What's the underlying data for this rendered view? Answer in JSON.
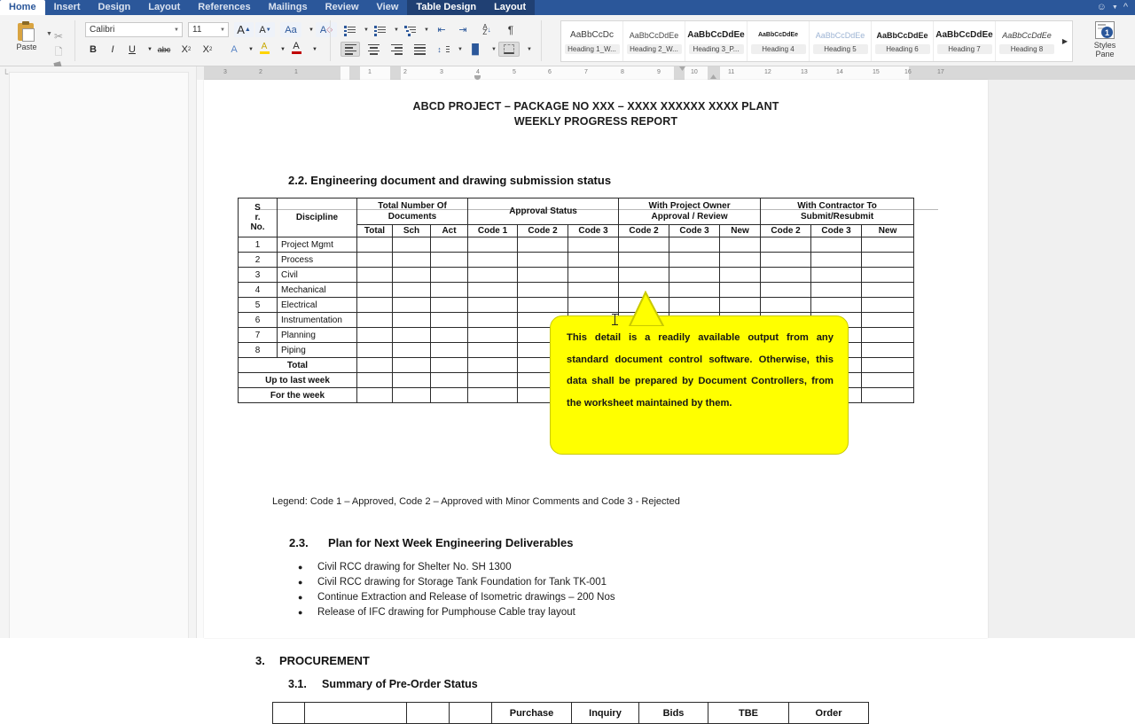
{
  "app": {
    "tabs": [
      {
        "label": "Home",
        "state": "active"
      },
      {
        "label": "Insert",
        "state": "normal"
      },
      {
        "label": "Design",
        "state": "normal"
      },
      {
        "label": "Layout",
        "state": "normal"
      },
      {
        "label": "References",
        "state": "normal"
      },
      {
        "label": "Mailings",
        "state": "normal"
      },
      {
        "label": "Review",
        "state": "normal"
      },
      {
        "label": "View",
        "state": "normal"
      },
      {
        "label": "Table Design",
        "state": "contextual"
      },
      {
        "label": "Layout",
        "state": "contextual"
      }
    ],
    "tabbar_right": {
      "smiley_icon": "smiley-face-icon",
      "collapse_icon": "collapse-ribbon-icon"
    },
    "accent_color": "#2b579a",
    "contextual_tab_color": "#204073"
  },
  "ribbon": {
    "clipboard": {
      "paste_label": "Paste",
      "paste_icon": "clipboard-paste-icon",
      "cut_icon": "scissors-icon",
      "copy_icon": "copy-icon",
      "format_painter_icon": "format-painter-icon"
    },
    "font": {
      "font_name": "Calibri",
      "font_size": "11",
      "grow_font_label": "A",
      "shrink_font_label": "A",
      "change_case_label": "Aa",
      "clear_formatting_icon": "clear-formatting-icon",
      "bold_label": "B",
      "italic_label": "I",
      "underline_label": "U",
      "strikethrough_label": "abc",
      "subscript_label": "X",
      "subscript_index": "2",
      "superscript_label": "X",
      "superscript_index": "2",
      "text_effects_label": "A",
      "highlight_label": "A",
      "font_color_label": "A",
      "highlight_color": "#ffd400",
      "font_color": "#c00000",
      "text_effects_color": "#2b579a"
    },
    "paragraph": {
      "bullets_icon": "bullet-list-icon",
      "numbering_icon": "numbered-list-icon",
      "multilevel_icon": "multilevel-list-icon",
      "decrease_indent_icon": "decrease-indent-icon",
      "increase_indent_icon": "increase-indent-icon",
      "sort_icon": "sort-icon",
      "sort_label": "A\nZ",
      "show_marks_label": "¶",
      "align_left_icon": "align-left-icon",
      "align_center_icon": "align-center-icon",
      "align_right_icon": "align-right-icon",
      "justify_icon": "justify-icon",
      "line_spacing_icon": "line-spacing-icon",
      "shading_icon": "shading-icon",
      "borders_icon": "borders-icon"
    },
    "styles": {
      "items": [
        {
          "sample": "AaBbCcDc",
          "name": "Heading 1_W...",
          "weight": "normal",
          "style": "normal",
          "size": "10px",
          "color": "#3c3c3c"
        },
        {
          "sample": "AaBbCcDdEe",
          "name": "Heading 2_W...",
          "weight": "normal",
          "style": "normal",
          "size": "9px",
          "color": "#4a4a4a"
        },
        {
          "sample": "AaBbCcDdEе",
          "name": "Heading 3_P...",
          "weight": "bold",
          "style": "normal",
          "size": "10px",
          "color": "#1d1d1d"
        },
        {
          "sample": "AaBbCcDdEe",
          "name": "Heading 4",
          "weight": "bold",
          "style": "normal",
          "size": "7px",
          "color": "#1d1d1d"
        },
        {
          "sample": "AaBbCcDdEe",
          "name": "Heading 5",
          "weight": "normal",
          "style": "normal",
          "size": "9px",
          "color": "#9db4d4"
        },
        {
          "sample": "AaBbCcDdEe",
          "name": "Heading 6",
          "weight": "bold",
          "style": "normal",
          "size": "9px",
          "color": "#1d1d1d"
        },
        {
          "sample": "AaBbCcDdEе",
          "name": "Heading 7",
          "weight": "bold",
          "style": "normal",
          "size": "10px",
          "color": "#1d1d1d"
        },
        {
          "sample": "AaBbCcDdEe",
          "name": "Heading 8",
          "weight": "normal",
          "style": "italic",
          "size": "9px",
          "color": "#3c3c3c"
        }
      ],
      "more_icon": "gallery-more-icon",
      "styles_pane_label": "Styles\nPane",
      "styles_pane_label_line1": "Styles",
      "styles_pane_label_line2": "Pane",
      "styles_pane_badge": "1"
    }
  },
  "ruler": {
    "left_ticks": [
      "3",
      "2",
      "1"
    ],
    "right_ticks": [
      "1",
      "2",
      "3",
      "4",
      "5",
      "6",
      "7",
      "8",
      "9",
      "10",
      "11",
      "12",
      "13",
      "14",
      "15",
      "16",
      "17"
    ]
  },
  "document": {
    "header_line1": "ABCD PROJECT – PACKAGE NO XXX – XXXX XXXXXX XXXX PLANT",
    "header_line2": "WEEKLY PROGRESS REPORT",
    "section_22_title": "2.2. Engineering document and drawing submission status",
    "table": {
      "group_headers": [
        {
          "label": "S\nr.\nNo.",
          "lines": [
            "S",
            "r.",
            "No."
          ]
        },
        {
          "label": "Discipline"
        },
        {
          "label": "Total Number Of Documents",
          "lines": [
            "Total Number Of",
            "Documents"
          ]
        },
        {
          "label": "Approval Status",
          "lines": [
            "Approval Status"
          ]
        },
        {
          "label": "With Project Owner Approval / Review",
          "lines": [
            "With Project Owner",
            "Approval / Review"
          ]
        },
        {
          "label": "With Contractor To Submit/Resubmit",
          "lines": [
            "With Contractor To",
            "Submit/Resubmit"
          ]
        }
      ],
      "sub_headers": [
        "Total",
        "Sch",
        "Act",
        "Code 1",
        "Code 2",
        "Code 3",
        "Code 2",
        "Code 3",
        "New",
        "Code 2",
        "Code 3",
        "New"
      ],
      "rows": [
        {
          "sr": "1",
          "discipline": "Project Mgmt"
        },
        {
          "sr": "2",
          "discipline": "Process"
        },
        {
          "sr": "3",
          "discipline": "Civil"
        },
        {
          "sr": "4",
          "discipline": "Mechanical"
        },
        {
          "sr": "5",
          "discipline": "Electrical"
        },
        {
          "sr": "6",
          "discipline": "Instrumentation"
        },
        {
          "sr": "7",
          "discipline": "Planning"
        },
        {
          "sr": "8",
          "discipline": "Piping"
        }
      ],
      "summary_rows": [
        "Total",
        "Up to last week",
        "For the week"
      ]
    },
    "callout_text": "This detail is a readily available output from any standard document control software. Otherwise, this data shall be prepared by Document Controllers, from the worksheet maintained by them.",
    "callout_color": "#ffff00",
    "legend": "Legend:  Code 1 – Approved,  Code 2 – Approved with Minor Comments and Code 3 - Rejected",
    "section_23_number": "2.3.",
    "section_23_title": "Plan for Next Week Engineering Deliverables",
    "bullets": [
      "Civil RCC  drawing for Shelter No. SH 1300",
      "Civil RCC drawing for Storage Tank Foundation for Tank TK-001",
      "Continue Extraction and Release of Isometric drawings – 200 Nos",
      "Release of IFC drawing for Pumphouse Cable tray layout"
    ],
    "section_3_number": "3.",
    "section_3_title": "PROCUREMENT",
    "section_31_number": "3.1.",
    "section_31_title": "Summary of Pre-Order Status",
    "table2_headers": [
      "Purchase",
      "Inquiry",
      "Bids",
      "TBE",
      "Order"
    ]
  }
}
